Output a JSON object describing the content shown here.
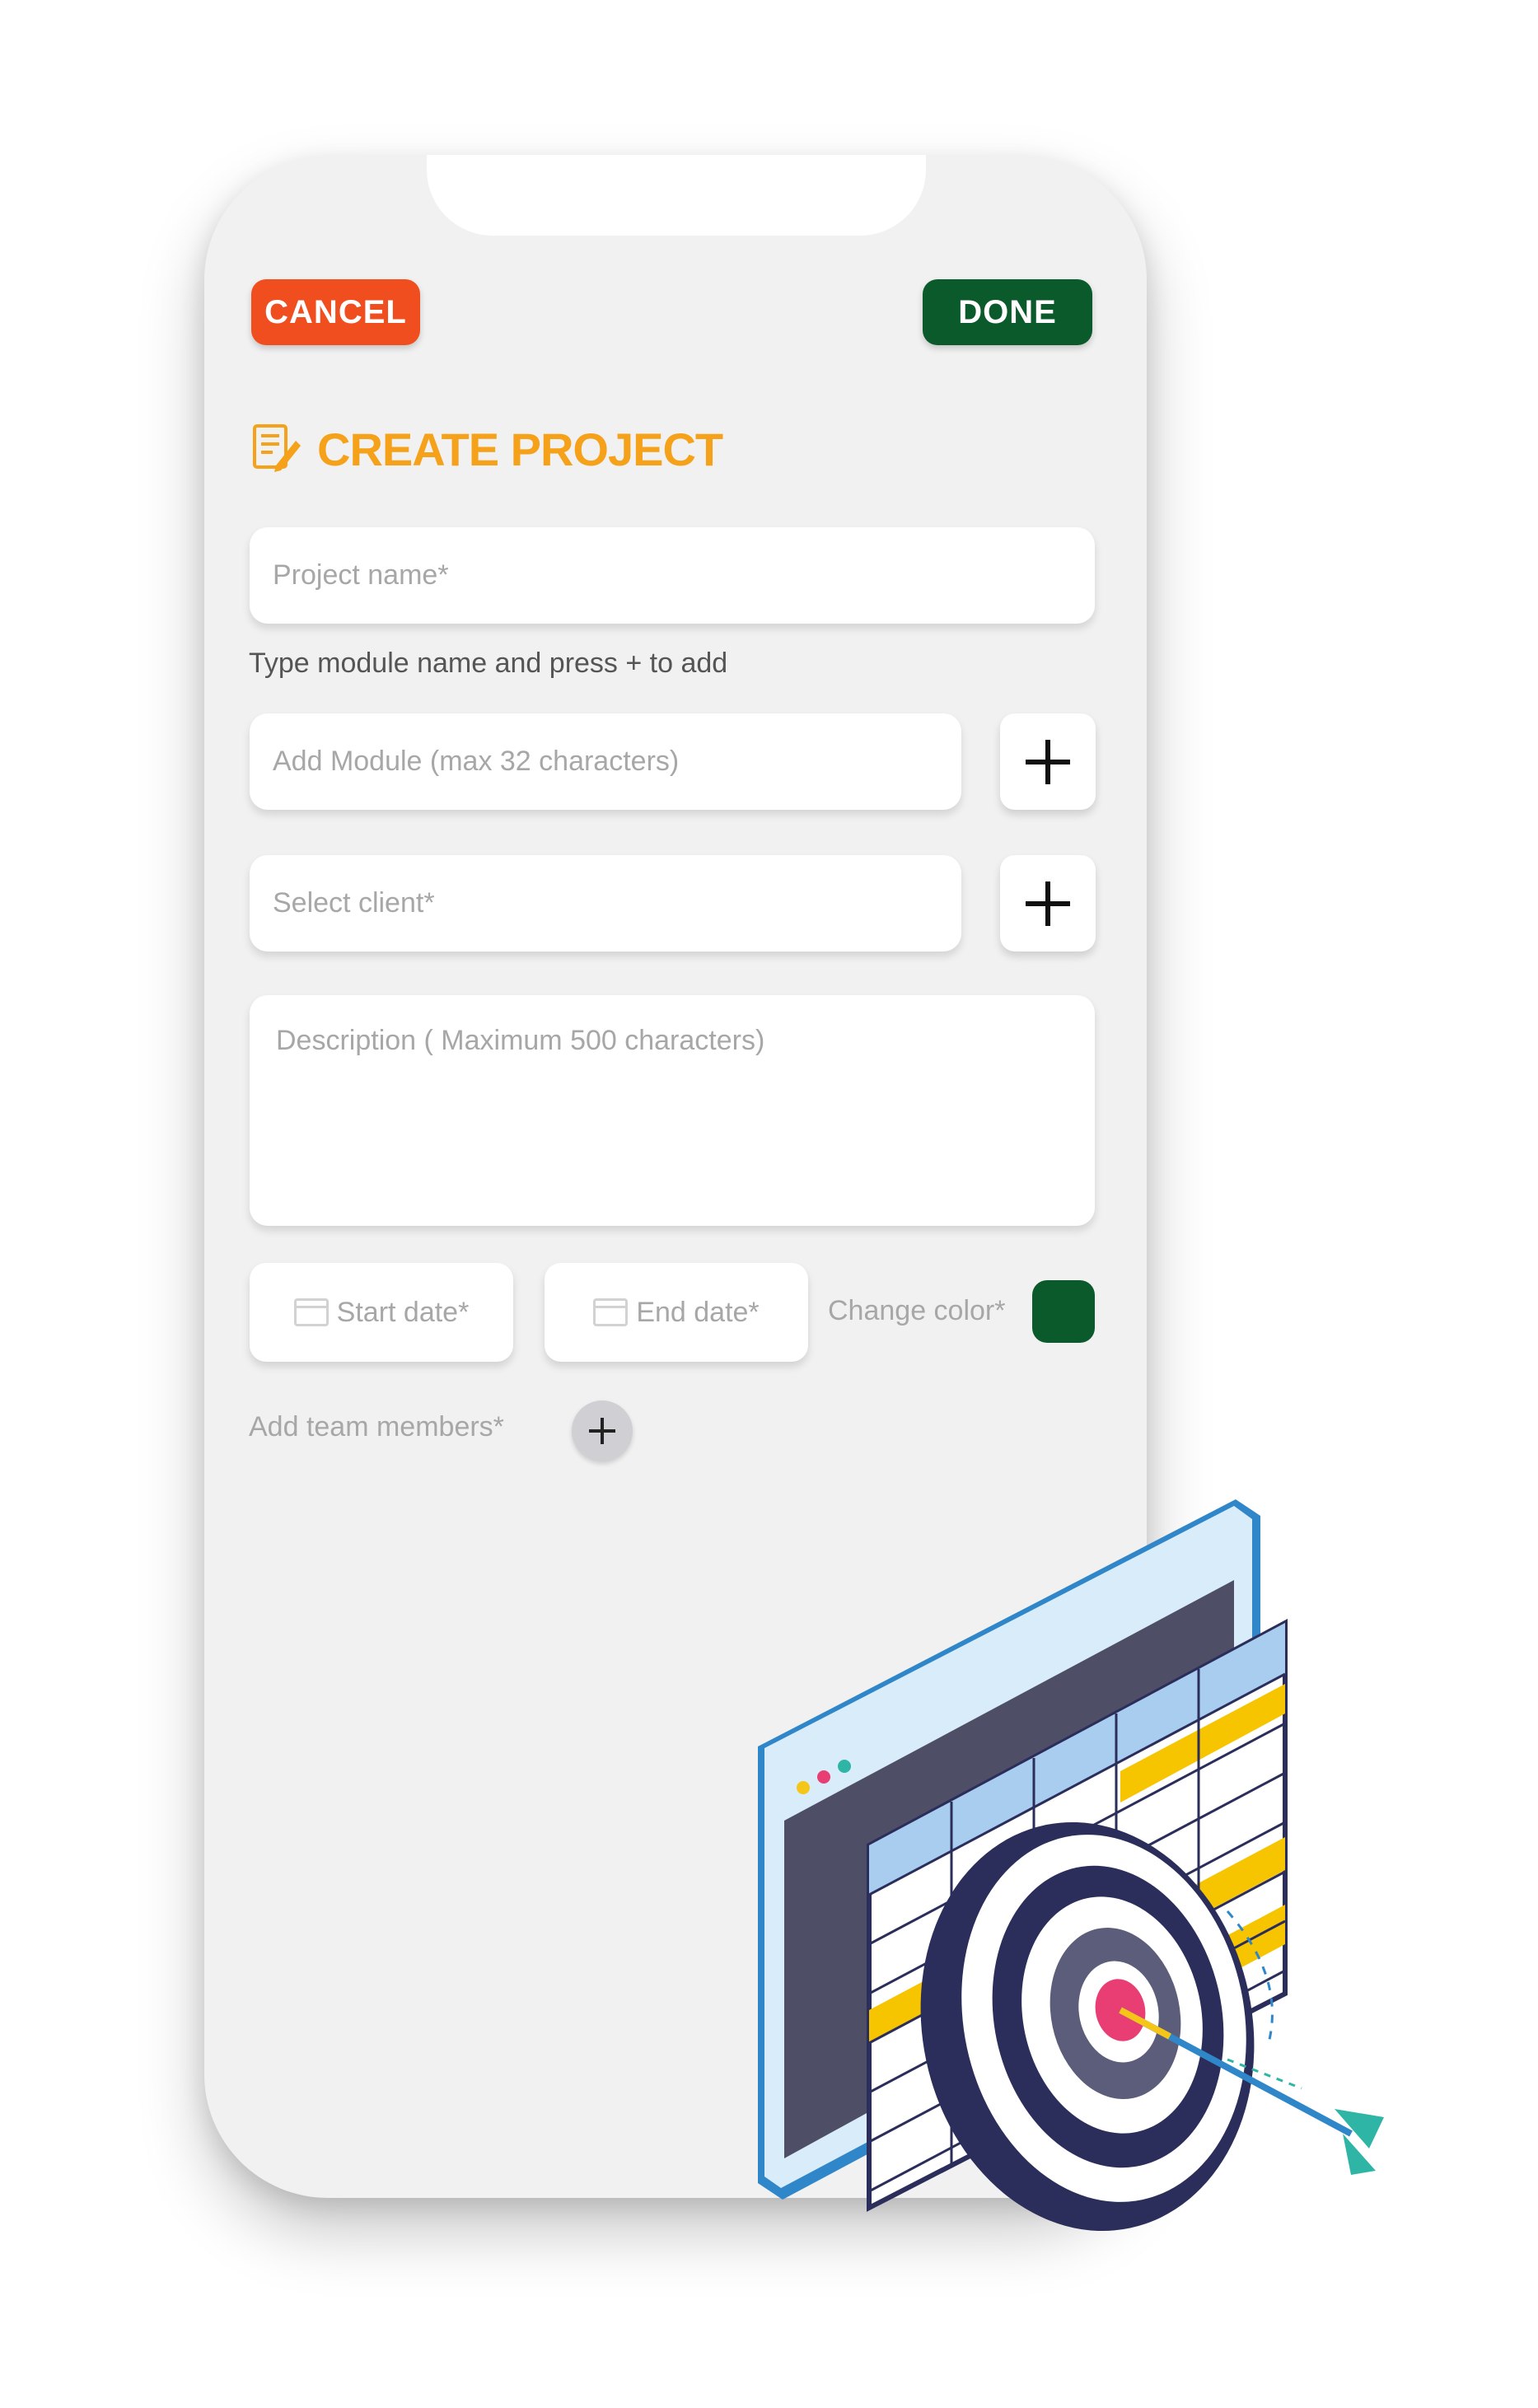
{
  "header": {
    "cancel_label": "CANCEL",
    "done_label": "DONE",
    "title": "CREATE PROJECT",
    "title_icon": "edit-document-icon"
  },
  "form": {
    "project_name_placeholder": "Project name*",
    "module_hint": "Type module name and press + to add",
    "module_placeholder": "Add Module (max 32 characters)",
    "client_placeholder": "Select client*",
    "description_placeholder": "Description ( Maximum 500 characters)",
    "start_date_label": "Start date*",
    "end_date_label": "End date*",
    "change_color_label": "Change color*",
    "selected_color": "#0b5a2c",
    "team_members_label": "Add team members*"
  },
  "colors": {
    "cancel": "#f04e1f",
    "done": "#0b5a2c",
    "title": "#f5a21a"
  }
}
